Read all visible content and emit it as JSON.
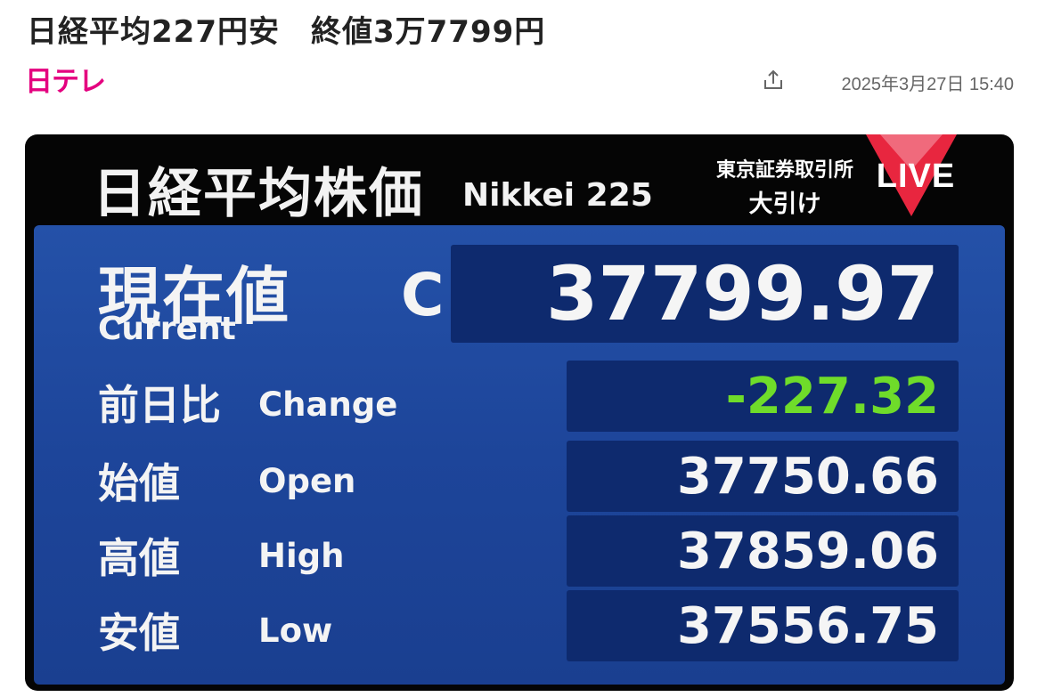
{
  "article": {
    "headline": "日経平均227円安　終値3万7799円",
    "source_logo": "日テレ",
    "date": "2025年3月27日 15:40"
  },
  "tv": {
    "title": "日経平均株価",
    "subtitle": "Nikkei 225",
    "exchange_line1": "東京証券取引所",
    "exchange_line2": "大引け",
    "live_label": "LIVE",
    "live_color": "#e8263f",
    "current": {
      "label_jp": "現在値",
      "label_en": "Current",
      "marker": "C",
      "value": "37799.97"
    },
    "rows": [
      {
        "label_jp": "前日比",
        "label_en": "Change",
        "value": "-227.32",
        "color": "#6fdc2a"
      },
      {
        "label_jp": "始値",
        "label_en": "Open",
        "value": "37750.66"
      },
      {
        "label_jp": "高値",
        "label_en": "High",
        "value": "37859.06"
      },
      {
        "label_jp": "安値",
        "label_en": "Low",
        "value": "37556.75"
      }
    ]
  },
  "icons": {
    "share": "share-icon"
  }
}
